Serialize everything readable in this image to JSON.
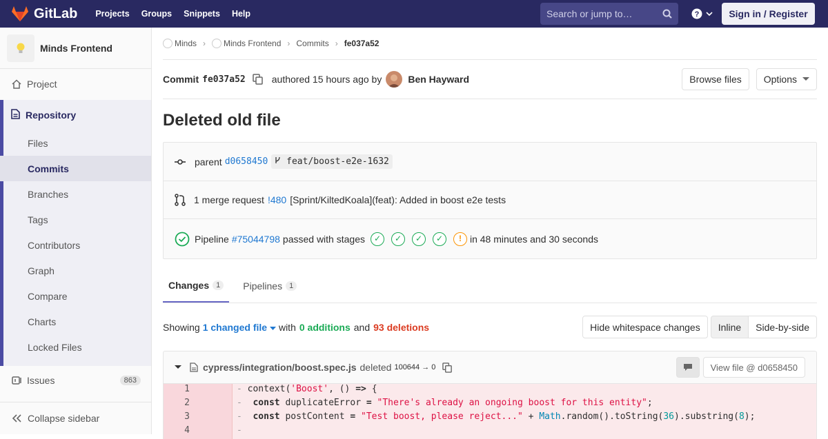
{
  "nav": {
    "brand": "GitLab",
    "links": [
      "Projects",
      "Groups",
      "Snippets",
      "Help"
    ],
    "search_placeholder": "Search or jump to…",
    "help_icon": "question-icon",
    "sign_in": "Sign in / Register"
  },
  "sidebar": {
    "project_name": "Minds Frontend",
    "project": "Project",
    "repository": "Repository",
    "sub": [
      "Files",
      "Commits",
      "Branches",
      "Tags",
      "Contributors",
      "Graph",
      "Compare",
      "Charts",
      "Locked Files"
    ],
    "issues": "Issues",
    "issues_count": "863",
    "collapse": "Collapse sidebar"
  },
  "breadcrumb": [
    "Minds",
    "Minds Frontend",
    "Commits",
    "fe037a52"
  ],
  "commit": {
    "label": "Commit",
    "sha": "fe037a52",
    "authored": "authored 15 hours ago by",
    "author": "Ben Hayward",
    "browse": "Browse files",
    "options": "Options",
    "title": "Deleted old file"
  },
  "info": {
    "parent_label": "parent",
    "parent_sha": "d0658450",
    "branch": "feat/boost-e2e-1632",
    "mr_text": "1 merge request",
    "mr_id": "!480",
    "mr_title": "[Sprint/KiltedKoala](feat): Added in boost e2e tests",
    "pipeline_label": "Pipeline",
    "pipeline_id": "#75044798",
    "pipeline_text": "passed with stages",
    "pipeline_duration": "in 48 minutes and 30 seconds"
  },
  "tabs": [
    {
      "label": "Changes",
      "count": "1"
    },
    {
      "label": "Pipelines",
      "count": "1"
    }
  ],
  "showing": {
    "prefix": "Showing",
    "files": "1 changed file",
    "with": "with",
    "additions": "0 additions",
    "and": "and",
    "deletions": "93 deletions",
    "hide_ws": "Hide whitespace changes",
    "inline": "Inline",
    "side": "Side-by-side"
  },
  "file": {
    "path": "cypress/integration/boost.spec.js",
    "status": "deleted",
    "mode": "100644 → 0",
    "view": "View file @ d0658450"
  },
  "diff": [
    {
      "n": "1",
      "parts": [
        [
          "",
          "context("
        ],
        [
          "str",
          "'Boost'"
        ],
        [
          "",
          ", () "
        ],
        [
          "kw",
          "=>"
        ],
        [
          "",
          " {"
        ]
      ]
    },
    {
      "n": "2",
      "parts": [
        [
          "",
          " "
        ],
        [
          "kw",
          "const"
        ],
        [
          "",
          " duplicateError "
        ],
        [
          "kw",
          "="
        ],
        [
          "",
          ""
        ],
        [
          "str",
          " \"There's already an ongoing boost for this entity\""
        ],
        [
          "",
          ";"
        ]
      ]
    },
    {
      "n": "3",
      "parts": [
        [
          "",
          " "
        ],
        [
          "kw",
          "const"
        ],
        [
          "",
          " postContent "
        ],
        [
          "kw",
          "="
        ],
        [
          "str",
          " \"Test boost, please reject...\""
        ],
        [
          "",
          " + "
        ],
        [
          "bi",
          "Math"
        ],
        [
          "",
          ".random().toString("
        ],
        [
          "num",
          "36"
        ],
        [
          "",
          ").substring("
        ],
        [
          "num",
          "8"
        ],
        [
          "",
          ");"
        ]
      ]
    },
    {
      "n": "4",
      "parts": []
    }
  ],
  "colors": {
    "nav": "#292961",
    "accent": "#1f78d1",
    "success": "#1aaa55",
    "warning": "#fc9403",
    "danger": "#db3b21"
  }
}
